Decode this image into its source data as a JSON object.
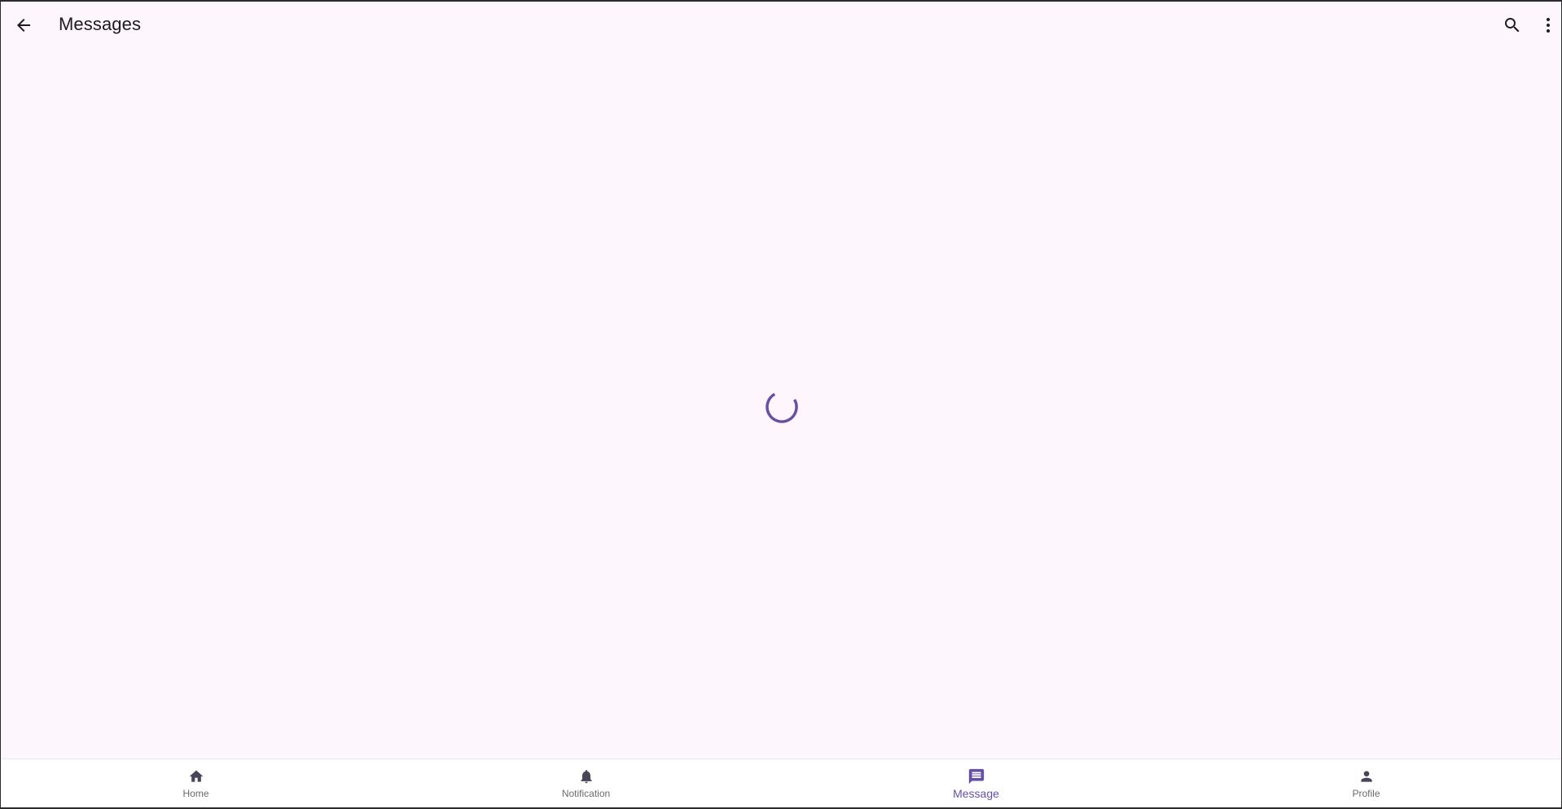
{
  "app_bar": {
    "title": "Messages",
    "back_icon": "arrow-back-icon",
    "search_icon": "search-icon",
    "more_icon": "more-vert-icon"
  },
  "loading": {
    "state": "loading",
    "spinner_color": "#6750a4"
  },
  "bottom_nav": {
    "items": [
      {
        "label": "Home",
        "icon": "home-icon",
        "active": false
      },
      {
        "label": "Notification",
        "icon": "bell-icon",
        "active": false
      },
      {
        "label": "Message",
        "icon": "message-icon",
        "active": true
      },
      {
        "label": "Profile",
        "icon": "person-icon",
        "active": false
      }
    ]
  },
  "colors": {
    "background": "#fdf7fd",
    "accent": "#6750a4",
    "icon_inactive": "#4a4458",
    "text_primary": "#1d1b20"
  }
}
